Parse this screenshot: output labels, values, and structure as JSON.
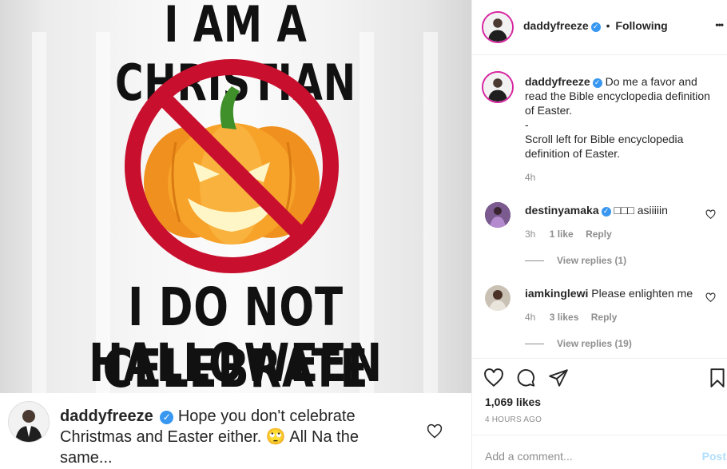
{
  "meme": {
    "top_text": "I AM A CHRISTIAN",
    "bottom_line1": "I DO NOT CELEBRATE",
    "bottom_line2": "HALLOWEEN"
  },
  "caption_overlay": {
    "username": "daddyfreeze",
    "text": "Hope you don't celebrate Christmas and Easter either. 🙄 All Na the same..."
  },
  "header": {
    "username": "daddyfreeze",
    "separator": "•",
    "follow_state": "Following",
    "more_label": "•••"
  },
  "caption": {
    "username": "daddyfreeze",
    "line1": "Do me a favor and read the Bible encyclopedia definition of Easter.",
    "line2": "-",
    "line3": "Scroll left for Bible encyclopedia definition of Easter.",
    "time": "4h"
  },
  "comments": [
    {
      "username": "destinyamaka",
      "text": "□□□ asiiiiin",
      "time": "3h",
      "likes": "1 like",
      "reply": "Reply",
      "view_replies": "View replies (1)"
    },
    {
      "username": "iamkinglewi",
      "text": "Please enlighten me",
      "time": "4h",
      "likes": "3 likes",
      "reply": "Reply",
      "view_replies": "View replies (19)"
    }
  ],
  "actions": {
    "likes": "1,069 likes",
    "timestamp": "4 HOURS AGO"
  },
  "add_comment": {
    "placeholder": "Add a comment...",
    "post_label": "Post"
  },
  "colors": {
    "verified": "#3897f0",
    "link_disabled": "#b2dffc",
    "story_ring": "#d6249f",
    "muted": "#8e8e8e"
  }
}
